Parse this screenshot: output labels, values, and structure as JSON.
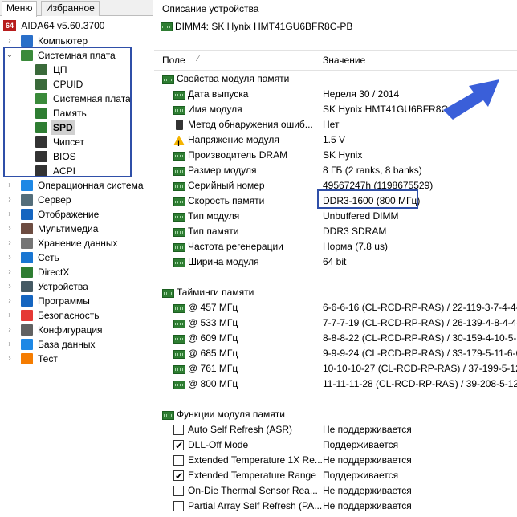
{
  "tabs": {
    "menu": "Меню",
    "favorites": "Избранное"
  },
  "app_version": "AIDA64 v5.60.3700",
  "app_badge": "64",
  "tree": [
    {
      "label": "Компьютер",
      "icon": "computer-icon",
      "color": "#2a6fc9",
      "level": 0,
      "exp": "›"
    },
    {
      "label": "Системная плата",
      "icon": "motherboard-icon",
      "color": "#3a8a3a",
      "level": 0,
      "exp": "⌄"
    },
    {
      "label": "ЦП",
      "icon": "cpu-icon",
      "color": "#3a6a3a",
      "level": 1,
      "exp": ""
    },
    {
      "label": "CPUID",
      "icon": "cpu-icon",
      "color": "#3a6a3a",
      "level": 1,
      "exp": ""
    },
    {
      "label": "Системная плата",
      "icon": "motherboard-icon",
      "color": "#3a8a3a",
      "level": 1,
      "exp": ""
    },
    {
      "label": "Память",
      "icon": "memory-icon",
      "color": "#2e7d32",
      "level": 1,
      "exp": ""
    },
    {
      "label": "SPD",
      "icon": "memory-icon",
      "color": "#2e7d32",
      "level": 1,
      "exp": "",
      "selected": true
    },
    {
      "label": "Чипсет",
      "icon": "chipset-icon",
      "color": "#333333",
      "level": 1,
      "exp": ""
    },
    {
      "label": "BIOS",
      "icon": "bios-icon",
      "color": "#333333",
      "level": 1,
      "exp": ""
    },
    {
      "label": "ACPI",
      "icon": "acpi-icon",
      "color": "#333333",
      "level": 1,
      "exp": ""
    },
    {
      "label": "Операционная система",
      "icon": "windows-icon",
      "color": "#1e88e5",
      "level": 0,
      "exp": "›"
    },
    {
      "label": "Сервер",
      "icon": "server-icon",
      "color": "#546e7a",
      "level": 0,
      "exp": "›"
    },
    {
      "label": "Отображение",
      "icon": "display-icon",
      "color": "#1565c0",
      "level": 0,
      "exp": "›"
    },
    {
      "label": "Мультимедиа",
      "icon": "multimedia-icon",
      "color": "#6d4c41",
      "level": 0,
      "exp": "›"
    },
    {
      "label": "Хранение данных",
      "icon": "storage-icon",
      "color": "#757575",
      "level": 0,
      "exp": "›"
    },
    {
      "label": "Сеть",
      "icon": "network-icon",
      "color": "#1976d2",
      "level": 0,
      "exp": "›"
    },
    {
      "label": "DirectX",
      "icon": "directx-icon",
      "color": "#2e7d32",
      "level": 0,
      "exp": "›"
    },
    {
      "label": "Устройства",
      "icon": "devices-icon",
      "color": "#455a64",
      "level": 0,
      "exp": "›"
    },
    {
      "label": "Программы",
      "icon": "programs-icon",
      "color": "#1565c0",
      "level": 0,
      "exp": "›"
    },
    {
      "label": "Безопасность",
      "icon": "security-shield-icon",
      "color": "#e53935",
      "level": 0,
      "exp": "›"
    },
    {
      "label": "Конфигурация",
      "icon": "config-icon",
      "color": "#616161",
      "level": 0,
      "exp": "›"
    },
    {
      "label": "База данных",
      "icon": "database-icon",
      "color": "#1e88e5",
      "level": 0,
      "exp": "›"
    },
    {
      "label": "Тест",
      "icon": "benchmark-icon",
      "color": "#f57c00",
      "level": 0,
      "exp": "›"
    }
  ],
  "right": {
    "desc_title": "Описание устройства",
    "device": "DIMM4: SK Hynix HMT41GU6BFR8C-PB",
    "col_field": "Поле",
    "col_value": "Значение"
  },
  "rows": [
    {
      "type": "sec",
      "field": "Свойства модуля памяти",
      "value": "",
      "icon": "chip"
    },
    {
      "type": "item",
      "field": "Дата выпуска",
      "value": "Неделя 30 / 2014",
      "icon": "chip"
    },
    {
      "type": "item",
      "field": "Имя модуля",
      "value": "SK Hynix HMT41GU6BFR8C-PB",
      "icon": "chip"
    },
    {
      "type": "item",
      "field": "Метод обнаружения ошиб...",
      "value": "Нет",
      "icon": "usb"
    },
    {
      "type": "item",
      "field": "Напряжение модуля",
      "value": "1.5 V",
      "icon": "warn"
    },
    {
      "type": "item",
      "field": "Производитель DRAM",
      "value": "SK Hynix",
      "icon": "chip"
    },
    {
      "type": "item",
      "field": "Размер модуля",
      "value": "8 ГБ (2 ranks, 8 banks)",
      "icon": "chip"
    },
    {
      "type": "item",
      "field": "Серийный номер",
      "value": "49567247h (1198675529)",
      "icon": "chip"
    },
    {
      "type": "item",
      "field": "Скорость памяти",
      "value": "DDR3-1600 (800 МГц)",
      "icon": "chip"
    },
    {
      "type": "item",
      "field": "Тип модуля",
      "value": "Unbuffered DIMM",
      "icon": "chip"
    },
    {
      "type": "item",
      "field": "Тип памяти",
      "value": "DDR3 SDRAM",
      "icon": "chip"
    },
    {
      "type": "item",
      "field": "Частота регенерации",
      "value": "Норма (7.8 us)",
      "icon": "chip"
    },
    {
      "type": "item",
      "field": "Ширина модуля",
      "value": "64 bit",
      "icon": "chip"
    },
    {
      "type": "blank"
    },
    {
      "type": "sec",
      "field": "Тайминги памяти",
      "value": "",
      "icon": "chip"
    },
    {
      "type": "item",
      "field": "@ 457 МГц",
      "value": "6-6-6-16  (CL-RCD-RP-RAS) / 22-119-3-7-4-4-",
      "icon": "chip"
    },
    {
      "type": "item",
      "field": "@ 533 МГц",
      "value": "7-7-7-19  (CL-RCD-RP-RAS) / 26-139-4-8-4-4-",
      "icon": "chip"
    },
    {
      "type": "item",
      "field": "@ 609 МГц",
      "value": "8-8-8-22  (CL-RCD-RP-RAS) / 30-159-4-10-5-5",
      "icon": "chip"
    },
    {
      "type": "item",
      "field": "@ 685 МГц",
      "value": "9-9-9-24  (CL-RCD-RP-RAS) / 33-179-5-11-6-6",
      "icon": "chip"
    },
    {
      "type": "item",
      "field": "@ 761 МГц",
      "value": "10-10-10-27  (CL-RCD-RP-RAS) / 37-199-5-12-",
      "icon": "chip"
    },
    {
      "type": "item",
      "field": "@ 800 МГц",
      "value": "11-11-11-28  (CL-RCD-RP-RAS) / 39-208-5-12-",
      "icon": "chip"
    },
    {
      "type": "blank"
    },
    {
      "type": "sec",
      "field": "Функции модуля памяти",
      "value": "",
      "icon": "chip"
    },
    {
      "type": "item",
      "field": "Auto Self Refresh (ASR)",
      "value": "Не поддерживается",
      "icon": "cb-off"
    },
    {
      "type": "item",
      "field": "DLL-Off Mode",
      "value": "Поддерживается",
      "icon": "cb-on"
    },
    {
      "type": "item",
      "field": "Extended Temperature 1X Re...",
      "value": "Не поддерживается",
      "icon": "cb-off"
    },
    {
      "type": "item",
      "field": "Extended Temperature Range",
      "value": "Поддерживается",
      "icon": "cb-on"
    },
    {
      "type": "item",
      "field": "On-Die Thermal Sensor Rea...",
      "value": "Не поддерживается",
      "icon": "cb-off"
    },
    {
      "type": "item",
      "field": "Partial Array Self Refresh (PA...",
      "value": "Не поддерживается",
      "icon": "cb-off"
    }
  ],
  "colors": {
    "selection_box": "#2f4fa8",
    "arrow": "#3a5fd9"
  }
}
